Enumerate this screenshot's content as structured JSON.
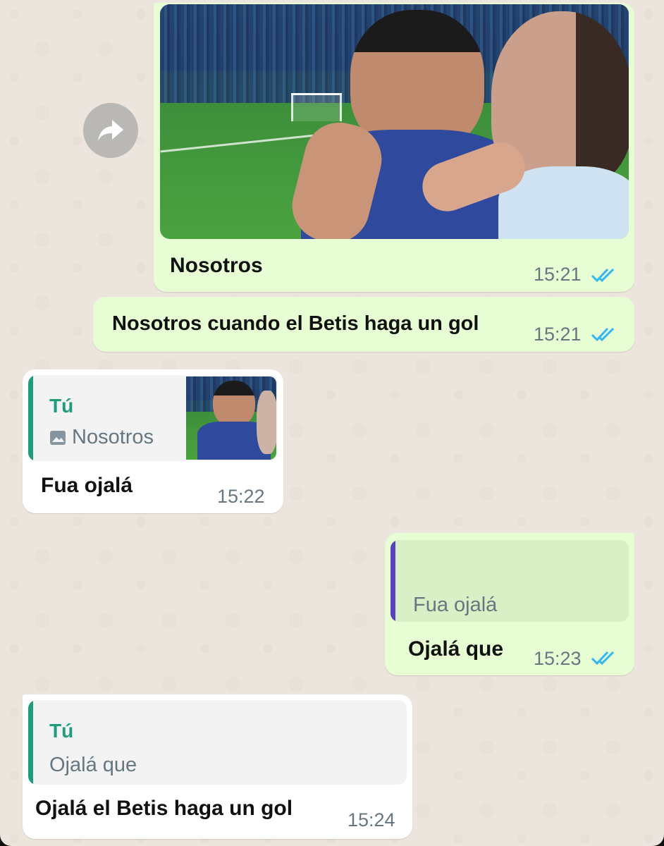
{
  "messages": [
    {
      "id": "m1",
      "direction": "out",
      "type": "image",
      "caption": "Nosotros",
      "time": "15:21",
      "status": "read"
    },
    {
      "id": "m2",
      "direction": "out",
      "type": "text",
      "text": "Nosotros cuando el Betis haga un gol",
      "time": "15:21",
      "status": "read"
    },
    {
      "id": "m3",
      "direction": "in",
      "type": "reply",
      "quote": {
        "author": "Tú",
        "text": "Nosotros",
        "has_thumbnail": true
      },
      "text": "Fua ojalá",
      "time": "15:22"
    },
    {
      "id": "m4",
      "direction": "out",
      "type": "reply",
      "quote": {
        "author": "",
        "text": "Fua ojalá"
      },
      "text": "Ojalá que",
      "time": "15:23",
      "status": "read"
    },
    {
      "id": "m5",
      "direction": "in",
      "type": "reply",
      "quote": {
        "author": "Tú",
        "text": "Ojalá que"
      },
      "text": "Ojalá el Betis haga un gol",
      "time": "15:24"
    }
  ],
  "colors": {
    "outgoing_bubble": "#e7fdd3",
    "incoming_bubble": "#ffffff",
    "chat_background": "#ece5dd",
    "read_ticks": "#34b7f1",
    "quote_author": "#1f9c7c",
    "quote_bar_incoming": "#1f9c7c",
    "quote_bar_outgoing": "#5b3fc4"
  },
  "icons": {
    "forward": "forward-arrow-icon",
    "read_status": "double-check-icon",
    "photo_quote": "image-icon"
  }
}
